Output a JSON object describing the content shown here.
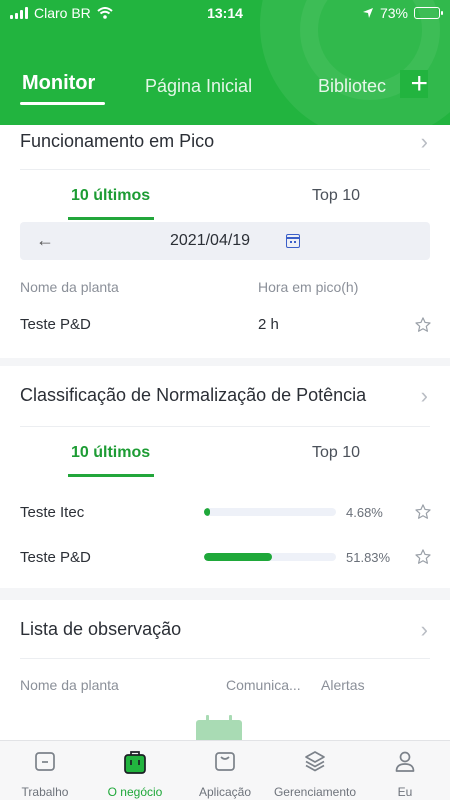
{
  "status": {
    "carrier": "Claro BR",
    "time": "13:14",
    "battery": "73%"
  },
  "topnav": {
    "tabs": [
      "Monitor",
      "Página Inicial",
      "Bibliotec"
    ],
    "active": 0
  },
  "peak": {
    "title": "Funcionamento em Pico",
    "seg": [
      "10 últimos",
      "Top 10"
    ],
    "date": "2021/04/19",
    "cols": [
      "Nome da planta",
      "Hora em pico(h)"
    ],
    "rows": [
      {
        "name": "Teste P&D",
        "value": "2 h"
      }
    ]
  },
  "norm": {
    "title": "Classificação de Normalização de Potência",
    "seg": [
      "10 últimos",
      "Top 10"
    ],
    "rows": [
      {
        "name": "Teste Itec",
        "pct_text": "4.68%",
        "pct": 4.68
      },
      {
        "name": "Teste P&D",
        "pct_text": "51.83%",
        "pct": 51.83
      }
    ]
  },
  "watch": {
    "title": "Lista de observação",
    "cols": [
      "Nome da planta",
      "Comunica...",
      "Alertas"
    ]
  },
  "tabbar": {
    "items": [
      {
        "label": "Trabalho",
        "icon": "work-icon"
      },
      {
        "label": "O negócio",
        "icon": "bag-icon"
      },
      {
        "label": "Aplicação",
        "icon": "app-icon"
      },
      {
        "label": "Gerenciamento",
        "icon": "layers-icon"
      },
      {
        "label": "Eu",
        "icon": "person-icon"
      }
    ],
    "active": 1
  },
  "colors": {
    "brand": "#22b43f",
    "accent": "#1fa83a"
  }
}
